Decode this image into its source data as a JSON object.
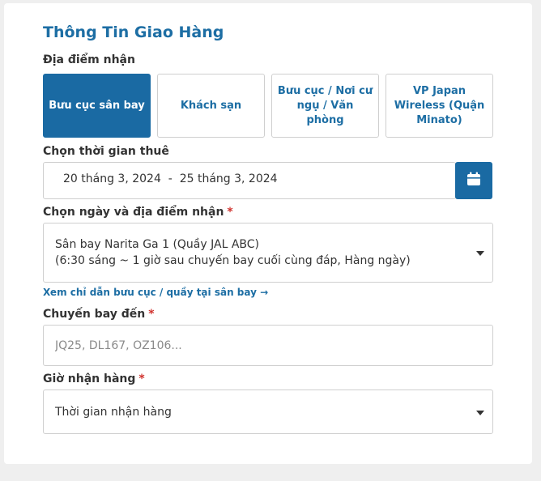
{
  "form": {
    "title": "Thông Tin Giao Hàng",
    "pickup_location_label": "Địa điểm nhận",
    "pickup_options": [
      "Bưu cục sân bay",
      "Khách sạn",
      "Bưu cục / Nơi cư ngụ / Văn phòng",
      "VP Japan Wireless (Quận Minato)"
    ],
    "selected_option": "Bưu cục sân bay",
    "rental_period_label": "Chọn thời gian thuê",
    "rental_period_value": "20 tháng 3, 2024  -  25 tháng 3, 2024",
    "date_location_label": "Chọn ngày và địa điểm nhận",
    "date_location_line1": "Sân bay Narita Ga 1 (Quầy JAL ABC)",
    "date_location_line2": "(6:30 sáng ~ 1 giờ sau chuyến bay cuối cùng đáp, Hàng ngày)",
    "guide_link": "Xem chỉ dẫn bưu cục / quầy tại sân bay →",
    "flight_label": "Chuyến bay đến",
    "flight_placeholder": "JQ25, DL167, OZ106...",
    "pickup_time_label": "Giờ nhận hàng",
    "pickup_time_value": "Thời gian nhận hàng",
    "required_mark": "*"
  },
  "colors": {
    "accent": "#1a6aa3",
    "title": "#1d6ea4",
    "required": "#d0312d"
  },
  "icons": {
    "calendar": "calendar-icon",
    "dropdown": "chevron-down-icon"
  }
}
